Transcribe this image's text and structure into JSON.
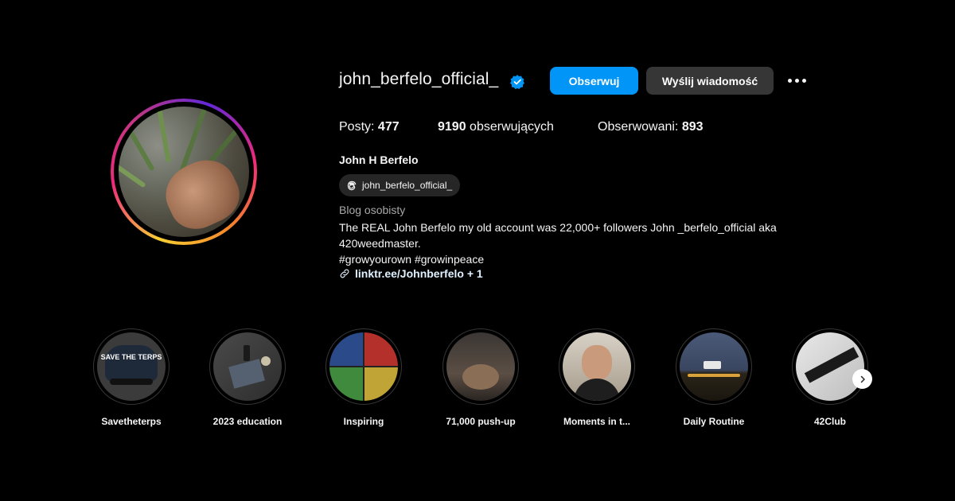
{
  "profile": {
    "username": "john_berfelo_official_",
    "follow_label": "Obserwuj",
    "message_label": "Wyślij wiadomość",
    "posts_label": "Posty:",
    "posts_count": "477",
    "followers_count": "9190",
    "followers_label": "obserwujących",
    "following_label": "Obserwowani:",
    "following_count": "893",
    "full_name": "John H Berfelo",
    "threads_handle": "john_berfelo_official_",
    "category": "Blog osobisty",
    "bio_lines": [
      "The REAL John Berfelo my old account was 22,000+ followers John _berfelo_official aka",
      "420weedmaster.",
      "#growyourown #growinpeace"
    ],
    "link_text": "linktr.ee/Johnberfelo + 1"
  },
  "highlights": [
    {
      "label": "Savetheterps",
      "thumb_text": "SAVE THE TERPS"
    },
    {
      "label": "2023 education"
    },
    {
      "label": "Inspiring"
    },
    {
      "label": "71,000 push-up"
    },
    {
      "label": "Moments in t..."
    },
    {
      "label": "Daily Routine"
    },
    {
      "label": "42Club"
    }
  ],
  "colors": {
    "accent": "#0095f6",
    "secondary_button": "#363636",
    "background": "#000000",
    "verified": "#0095f6"
  },
  "icons": {
    "verified": "verified-badge-icon",
    "more": "more-options-icon",
    "threads": "threads-icon",
    "link": "link-icon",
    "next": "chevron-right-icon"
  }
}
